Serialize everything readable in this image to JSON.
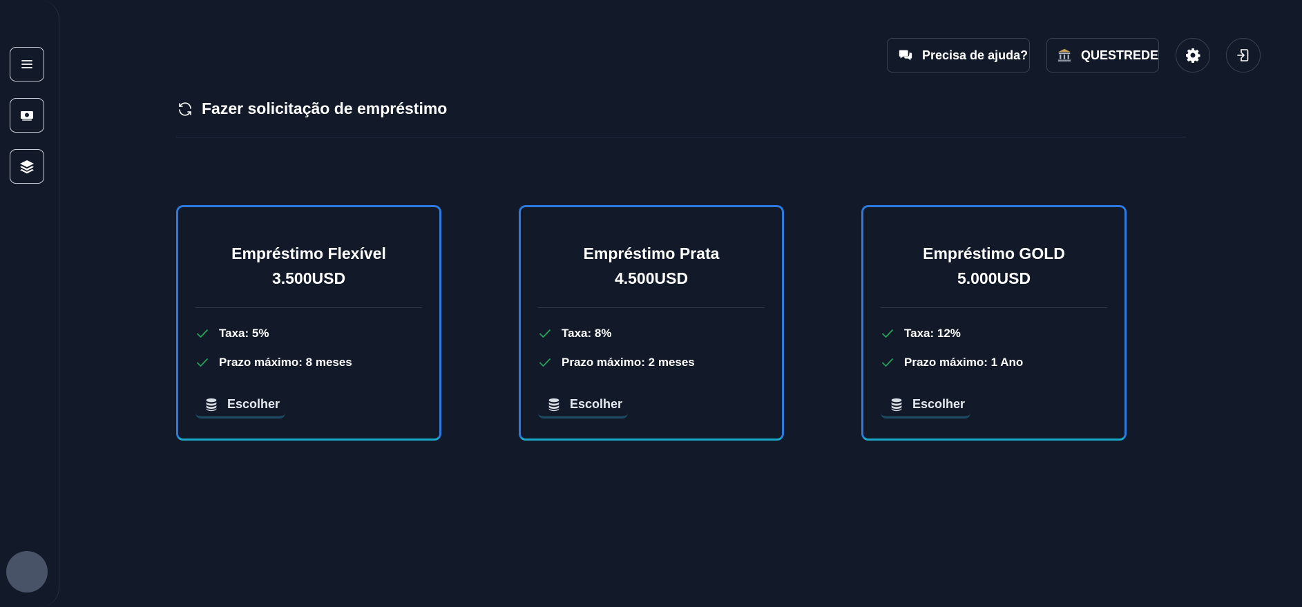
{
  "sidebar": {
    "items": [
      {
        "icon": "menu-icon"
      },
      {
        "icon": "money-icon"
      },
      {
        "icon": "layers-icon"
      }
    ]
  },
  "header": {
    "help_label": "Precisa de ajuda?",
    "bank_label": "QUESTREDE"
  },
  "main": {
    "title": "Fazer solicitação de empréstimo"
  },
  "loans": [
    {
      "name": "Empréstimo Flexível",
      "amount": "3.500USD",
      "rate": "Taxa: 5%",
      "term": "Prazo máximo: 8 meses",
      "button": "Escolher"
    },
    {
      "name": "Empréstimo Prata",
      "amount": "4.500USD",
      "rate": "Taxa: 8%",
      "term": "Prazo máximo: 2 meses",
      "button": "Escolher"
    },
    {
      "name": "Empréstimo GOLD",
      "amount": "5.000USD",
      "rate": "Taxa: 12%",
      "term": "Prazo máximo: 1 Ano",
      "button": "Escolher"
    }
  ],
  "colors": {
    "background": "#121929",
    "card_border": "#2d7be0",
    "check": "#22a35a"
  }
}
